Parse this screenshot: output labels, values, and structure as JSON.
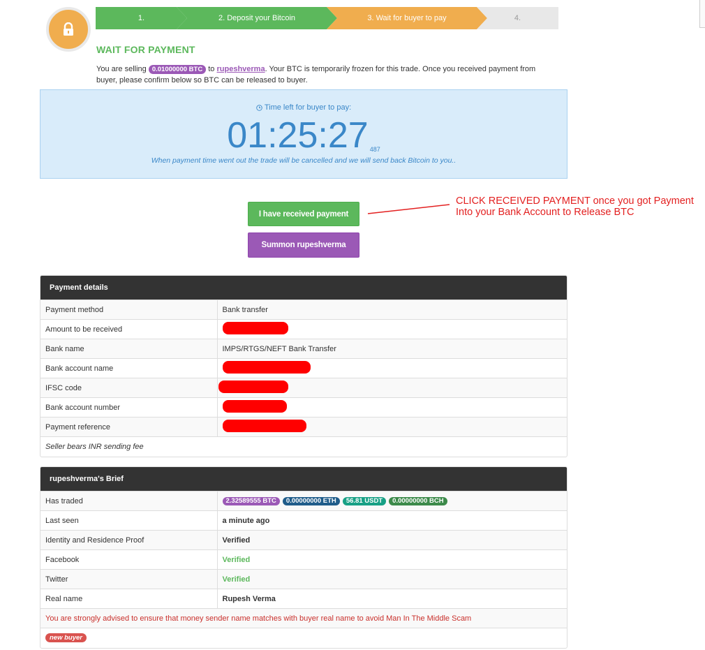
{
  "steps": [
    {
      "label": "1."
    },
    {
      "label": "2. Deposit your Bitcoin"
    },
    {
      "label": "3. Wait for buyer to pay"
    },
    {
      "label": "4."
    }
  ],
  "heading": "WAIT FOR PAYMENT",
  "intro": {
    "prefix": "You are selling ",
    "btc_amount": "0.01000000 BTC",
    "to": " to ",
    "buyer": "rupeshverma",
    "suffix": ". Your BTC is temporarily frozen for this trade. Once you received payment from buyer, please confirm below so BTC can be released to buyer."
  },
  "timer": {
    "label": "Time left for buyer to pay:",
    "value": "01:25:27",
    "ms": "487",
    "note": "When payment time went out the trade will be cancelled and we will send back Bitcoin to you.."
  },
  "buttons": {
    "received": "I have received payment",
    "summon": "Summon rupeshverma"
  },
  "annotation": {
    "line1": "CLICK RECEIVED PAYMENT once you got Payment",
    "line2": "Into your Bank Account to Release BTC"
  },
  "payment_details": {
    "title": "Payment details",
    "rows": [
      {
        "key": "Payment method",
        "value": "Bank transfer"
      },
      {
        "key": "Amount to be received",
        "value": ""
      },
      {
        "key": "Bank name",
        "value": "IMPS/RTGS/NEFT Bank Transfer"
      },
      {
        "key": "Bank account name",
        "value": ""
      },
      {
        "key": "IFSC code",
        "value": ""
      },
      {
        "key": "Bank account number",
        "value": ""
      },
      {
        "key": "Payment reference",
        "value": ""
      }
    ],
    "note": "Seller bears INR sending fee"
  },
  "brief": {
    "title": "rupeshverma's Brief",
    "has_traded_label": "Has traded",
    "traded": [
      "2.32589555 BTC",
      "0.00000000 ETH",
      "56.81 USDT",
      "0.00000000 BCH"
    ],
    "rows": [
      {
        "key": "Last seen",
        "value": "a minute ago"
      },
      {
        "key": "Identity and Residence Proof",
        "value": "Verified"
      },
      {
        "key": "Facebook",
        "value": "Verified"
      },
      {
        "key": "Twitter",
        "value": "Verified"
      },
      {
        "key": "Real name",
        "value": "Rupesh Verma"
      }
    ],
    "warning": "You are strongly advised to ensure that money sender name matches with buyer real name to avoid Man In The Middle Scam",
    "badge": "new buyer"
  },
  "colors": {
    "green": "#5cb85c",
    "orange": "#f0ad4e",
    "purple": "#9b59b6",
    "timer_blue": "#3a87c8",
    "annotation_red": "#e32020"
  }
}
